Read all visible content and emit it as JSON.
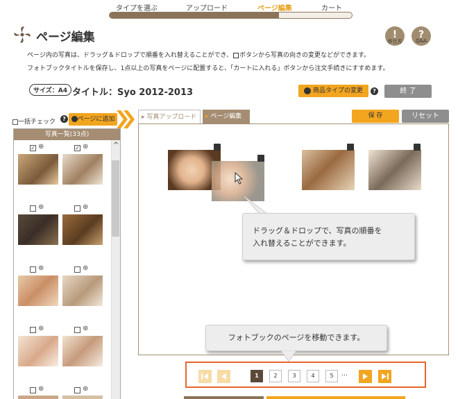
{
  "steps": {
    "items": [
      "タイプを選ぶ",
      "アップロード",
      "ページ編集",
      "カート"
    ],
    "active_index": 2,
    "progress": 0.7
  },
  "header": {
    "title": "ページ編集",
    "help_label": "作り方",
    "qa_label": "Q&A"
  },
  "description": {
    "line1": "ページ内の写真は、ドラッグ＆ドロップで順番を入れ替えることができ、",
    "line1b": "ボタンから写真の向きの変更などができます。",
    "line2": "フォトブックタイトルを保存し、1点以上の写真をページに配置すると、「カートに入れる」ボタンから注文手続きにすすめます。"
  },
  "book": {
    "size_label": "サイズ：A4",
    "title": "タイトル：Syo 2012-2013"
  },
  "buttons": {
    "change_type": "商品タイプの変更",
    "finish": "終 了",
    "save": "保 存",
    "reset": "リセット",
    "add_to_page": "ページに追加"
  },
  "sidebar": {
    "select_all": "一括チェック",
    "list_header": "写真一覧(33点)"
  },
  "tabs": {
    "upload": "写真アップロード",
    "edit": "ページ編集"
  },
  "tooltips": {
    "drag_drop_line1": "ドラッグ＆ドロップで、写真の順番を",
    "drag_drop_line2": "入れ替えることができます。",
    "pager": "フォトブックのページを移動できます。"
  },
  "pager": {
    "pages": [
      "1",
      "2",
      "3",
      "4",
      "5"
    ],
    "current": "1",
    "ellipsis": "…"
  },
  "colors": {
    "accent": "#f2a51f",
    "brown": "#a48d72",
    "highlight": "#e8652a"
  }
}
